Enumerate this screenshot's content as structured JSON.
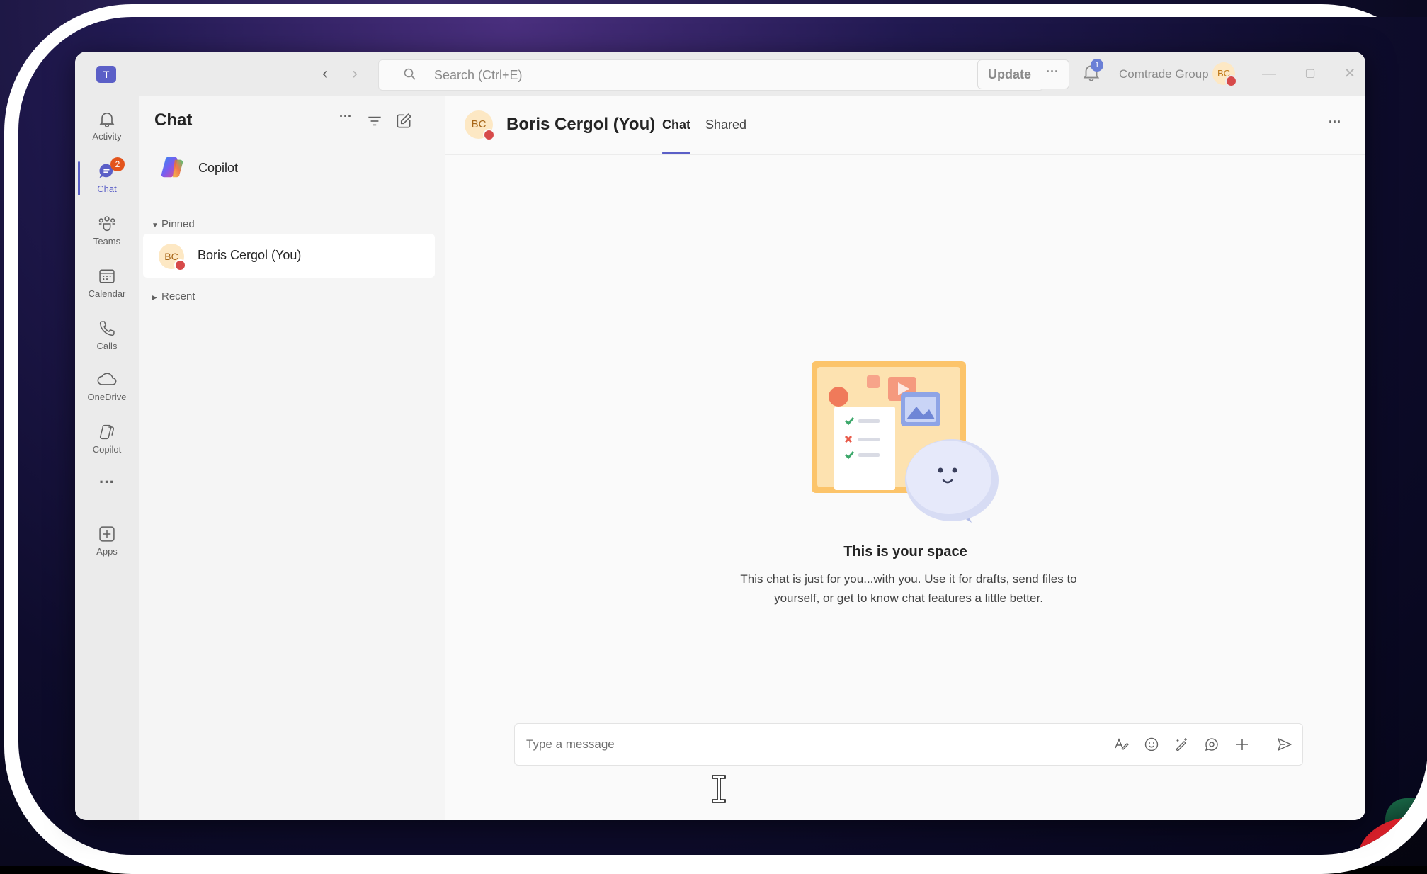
{
  "titlebar": {
    "search_placeholder": "Search (Ctrl+E)",
    "update_label": "Update",
    "update_more": "···",
    "notification_count": "1",
    "org_name": "Comtrade Group",
    "user_initials": "BC",
    "minimize": "—",
    "restore": "▢",
    "close": "✕"
  },
  "rail": {
    "items": [
      {
        "label": "Activity",
        "icon": "bell-icon"
      },
      {
        "label": "Chat",
        "icon": "chat-icon",
        "badge": "2",
        "active": true
      },
      {
        "label": "Teams",
        "icon": "teams-icon"
      },
      {
        "label": "Calendar",
        "icon": "calendar-icon"
      },
      {
        "label": "Calls",
        "icon": "phone-icon"
      },
      {
        "label": "OneDrive",
        "icon": "cloud-icon"
      },
      {
        "label": "Copilot",
        "icon": "copilot-icon"
      },
      {
        "label": "···",
        "icon": "more-icon"
      },
      {
        "label": "Apps",
        "icon": "add-apps-icon"
      }
    ]
  },
  "chatlist": {
    "title": "Chat",
    "more": "···",
    "copilot_name": "Copilot",
    "pinned_label": "Pinned",
    "recent_label": "Recent",
    "pinned": [
      {
        "initials": "BC",
        "name": "Boris Cergol (You)"
      }
    ]
  },
  "main": {
    "initials": "BC",
    "name": "Boris Cergol (You)",
    "tabs": [
      {
        "label": "Chat",
        "active": true
      },
      {
        "label": "Shared",
        "active": false
      }
    ],
    "more": "···",
    "empty_title": "This is your space",
    "empty_desc": "This chat is just for you...with you. Use it for drafts, send files to yourself, or get to know chat features a little better.",
    "composer_placeholder": "Type a message"
  },
  "colors": {
    "accent": "#5b5fc7",
    "badge": "#e3541c",
    "busy": "#d74a4a",
    "avatar_bg": "#fde8c4"
  }
}
